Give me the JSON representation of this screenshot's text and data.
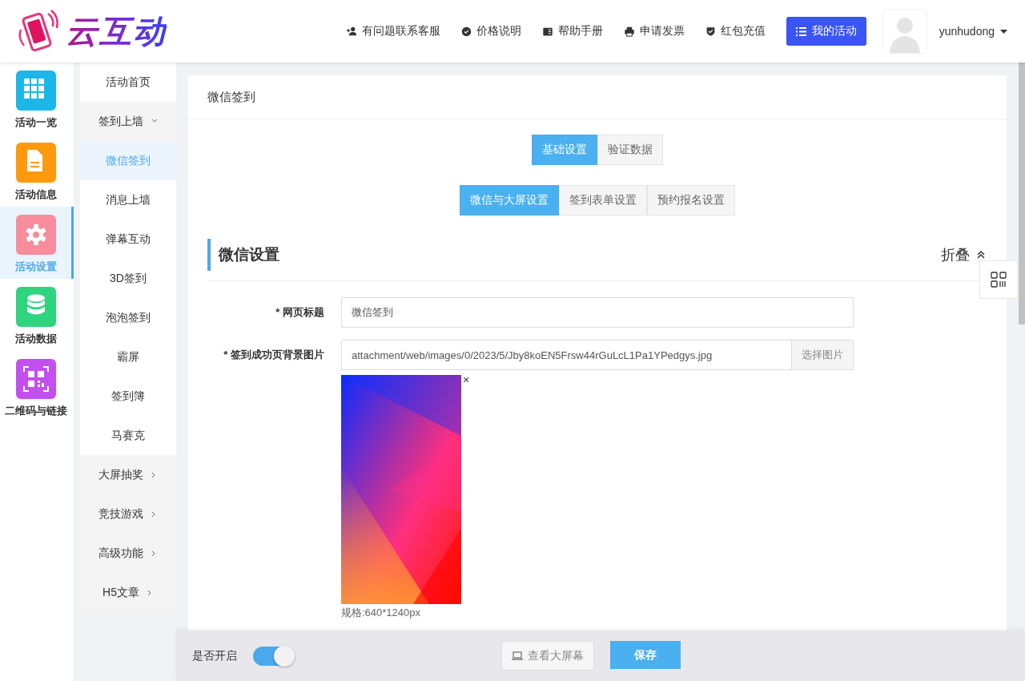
{
  "header": {
    "logo_text": "云互动",
    "links": [
      {
        "kind": "support",
        "label": "有问题联系客服"
      },
      {
        "kind": "price",
        "label": "价格说明"
      },
      {
        "kind": "manual",
        "label": "帮助手册"
      },
      {
        "kind": "invoice",
        "label": "申请发票"
      },
      {
        "kind": "recharge",
        "label": "红包充值"
      }
    ],
    "my_activity_button": "我的活动",
    "user_name": "yunhudong"
  },
  "icon_nav": [
    {
      "kind": "grid",
      "label": "活动一览",
      "color": "#1cb6e9",
      "selected": false
    },
    {
      "kind": "document",
      "label": "活动信息",
      "color": "#ff9a0e",
      "selected": false
    },
    {
      "kind": "gear",
      "label": "活动设置",
      "color": "#f78d9c",
      "selected": true
    },
    {
      "kind": "database",
      "label": "活动数据",
      "color": "#2fd47e",
      "selected": false
    },
    {
      "kind": "qrcode",
      "label": "二维码与链接",
      "color": "#c44ff0",
      "selected": false
    }
  ],
  "sub_menu": [
    {
      "label": "活动首页",
      "selected": false
    },
    {
      "label": "签到上墙",
      "selected": false,
      "expanded": true
    },
    {
      "label": "微信签到",
      "selected": true
    },
    {
      "label": "消息上墙",
      "selected": false
    },
    {
      "label": "弹幕互动",
      "selected": false
    },
    {
      "label": "3D签到",
      "selected": false
    },
    {
      "label": "泡泡签到",
      "selected": false
    },
    {
      "label": "霸屏",
      "selected": false
    },
    {
      "label": "签到簿",
      "selected": false
    },
    {
      "label": "马赛克",
      "selected": false
    },
    {
      "label": "大屏抽奖",
      "selected": false,
      "expanded": false
    },
    {
      "label": "竞技游戏",
      "selected": false,
      "expanded": false
    },
    {
      "label": "高级功能",
      "selected": false,
      "expanded": false
    },
    {
      "label": "H5文章",
      "selected": false,
      "expanded": false
    }
  ],
  "page_title": "微信签到",
  "tabs": [
    {
      "label": "基础设置",
      "selected": true
    },
    {
      "label": "验证数据",
      "selected": false
    }
  ],
  "sub_tabs": [
    {
      "label": "微信与大屏设置",
      "selected": true
    },
    {
      "label": "签到表单设置",
      "selected": false
    },
    {
      "label": "预约报名设置",
      "selected": false
    }
  ],
  "section": {
    "title": "微信设置",
    "collapse_label": "折叠"
  },
  "fields": [
    {
      "kind": "text",
      "label": "* 网页标题",
      "value": "微信签到"
    },
    {
      "label": "* 签到成功页背景图片",
      "value": "attachment/web/images/0/2023/5/Jby8koEN5Frsw44rGuLcL1Pa1YPedgys.jpg",
      "button": "选择图片",
      "remove_mark": "×",
      "note": "规格:640*1240px"
    }
  ],
  "footer": {
    "toggle_label": "是否开启",
    "toggle_on": true,
    "screen_button": "查看大屏幕",
    "save_button": "保存"
  }
}
